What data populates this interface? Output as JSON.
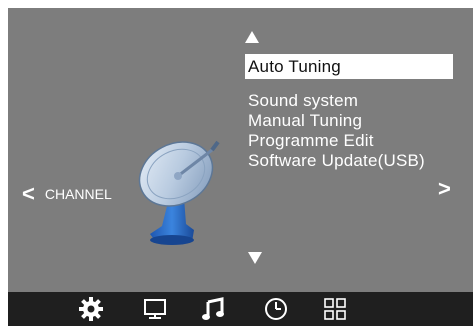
{
  "menu": {
    "items": [
      {
        "label": "Auto Tuning",
        "selected": true
      },
      {
        "label": "Sound system",
        "selected": false
      },
      {
        "label": "Manual Tuning",
        "selected": false
      },
      {
        "label": "Programme Edit",
        "selected": false
      },
      {
        "label": "Software Update(USB)",
        "selected": false
      }
    ]
  },
  "nav": {
    "left_arrow": "<",
    "left_label": "CHANNEL",
    "right_arrow": ">"
  },
  "tabs": [
    {
      "icon": "gear-icon",
      "active": true
    },
    {
      "icon": "monitor-icon",
      "active": false
    },
    {
      "icon": "music-note-icon",
      "active": false
    },
    {
      "icon": "clock-icon",
      "active": false
    },
    {
      "icon": "grid-icon",
      "active": false
    }
  ],
  "colors": {
    "screen_bg": "#7d7d7d",
    "bar_bg": "#1f1f1f",
    "highlight_bg": "#ffffff",
    "text": "#ffffff"
  }
}
